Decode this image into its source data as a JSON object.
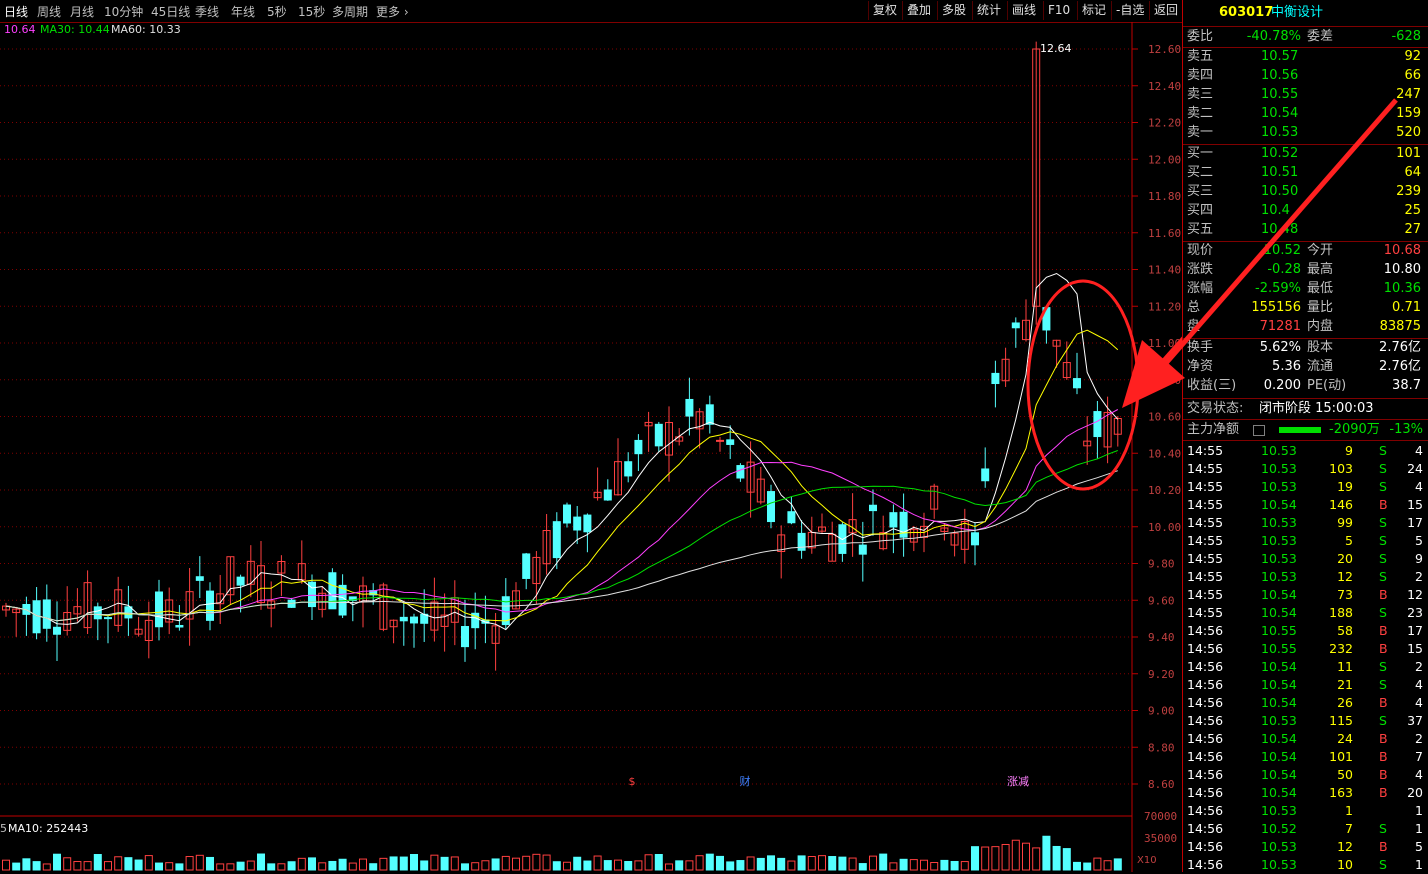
{
  "toolbar": {
    "periods": [
      "日线",
      "周线",
      "月线",
      "10分钟",
      "45日线",
      "季线",
      "年线",
      "5秒",
      "15秒",
      "多周期",
      "更多"
    ],
    "buttons": [
      "复权",
      "叠加",
      "多股",
      "统计",
      "画线",
      "F10",
      "标记",
      "-自选",
      "返回"
    ]
  },
  "ma_labels": {
    "current": "10.64",
    "ma30": "MA30: 10.44",
    "ma60": "MA60: 10.33"
  },
  "price_axis": [
    "12.60",
    "12.40",
    "12.20",
    "12.00",
    "11.80",
    "11.60",
    "11.40",
    "11.20",
    "11.00",
    "10.80",
    "10.60",
    "10.40",
    "10.20",
    "10.00",
    "9.80",
    "9.60",
    "9.40",
    "9.20",
    "9.00",
    "8.80",
    "8.60"
  ],
  "high_annotation": "12.64",
  "markers": {
    "m1": "$",
    "m2": "财",
    "m3": "涨减"
  },
  "volume": {
    "label_left": "5",
    "ma10": "MA10: 252443",
    "ticks": [
      "70000",
      "35000"
    ],
    "scale": "X10"
  },
  "stock": {
    "code": "603017",
    "name": "中衡设计"
  },
  "order_book": {
    "weibi_label": "委比",
    "weibi": "-40.78%",
    "weicha_label": "委差",
    "weicha": "-628",
    "sells": [
      {
        "label": "卖五",
        "price": "10.57",
        "vol": "92"
      },
      {
        "label": "卖四",
        "price": "10.56",
        "vol": "66"
      },
      {
        "label": "卖三",
        "price": "10.55",
        "vol": "247"
      },
      {
        "label": "卖二",
        "price": "10.54",
        "vol": "159"
      },
      {
        "label": "卖一",
        "price": "10.53",
        "vol": "520"
      }
    ],
    "buys": [
      {
        "label": "买一",
        "price": "10.52",
        "vol": "101"
      },
      {
        "label": "买二",
        "price": "10.51",
        "vol": "64"
      },
      {
        "label": "买三",
        "price": "10.50",
        "vol": "239"
      },
      {
        "label": "买四",
        "price": "10.4",
        "vol": "25"
      },
      {
        "label": "买五",
        "price": "10.48",
        "vol": "27"
      }
    ]
  },
  "quote": [
    {
      "l1": "现价",
      "v1": "10.52",
      "c1": "dn",
      "l2": "今开",
      "v2": "10.68",
      "c2": "up"
    },
    {
      "l1": "涨跌",
      "v1": "-0.28",
      "c1": "dn",
      "l2": "最高",
      "v2": "10.80",
      "c2": "wht"
    },
    {
      "l1": "涨幅",
      "v1": "-2.59%",
      "c1": "dn",
      "l2": "最低",
      "v2": "10.36",
      "c2": "dn"
    },
    {
      "l1": "总",
      "v1": "155156",
      "c1": "yel",
      "l2": "量比",
      "v2": "0.71",
      "c2": "yel"
    },
    {
      "l1": "盘",
      "v1": "71281",
      "c1": "up",
      "l2": "内盘",
      "v2": "83875",
      "c2": "yel"
    }
  ],
  "stats": [
    {
      "l1": "换手",
      "v1": "5.62%",
      "l2": "股本",
      "v2": "2.76亿"
    },
    {
      "l1": "净资",
      "v1": "5.36",
      "l2": "流通",
      "v2": "2.76亿"
    },
    {
      "l1": "收益(三)",
      "v1": "0.200",
      "l2": "PE(动)",
      "v2": "38.7"
    }
  ],
  "status": {
    "label": "交易状态:",
    "value": "闭市阶段 15:00:03"
  },
  "main_force": {
    "label": "主力净额",
    "value": "-2090万",
    "pct": "-13%"
  },
  "ticks": [
    {
      "t": "14:55",
      "p": "10.53",
      "v": "9",
      "d": "S",
      "n": "4"
    },
    {
      "t": "14:55",
      "p": "10.53",
      "v": "103",
      "d": "S",
      "n": "24"
    },
    {
      "t": "14:55",
      "p": "10.53",
      "v": "19",
      "d": "S",
      "n": "4"
    },
    {
      "t": "14:55",
      "p": "10.54",
      "v": "146",
      "d": "B",
      "n": "15"
    },
    {
      "t": "14:55",
      "p": "10.53",
      "v": "99",
      "d": "S",
      "n": "17"
    },
    {
      "t": "14:55",
      "p": "10.53",
      "v": "5",
      "d": "S",
      "n": "5"
    },
    {
      "t": "14:55",
      "p": "10.53",
      "v": "20",
      "d": "S",
      "n": "9"
    },
    {
      "t": "14:55",
      "p": "10.53",
      "v": "12",
      "d": "S",
      "n": "2"
    },
    {
      "t": "14:55",
      "p": "10.54",
      "v": "73",
      "d": "B",
      "n": "12"
    },
    {
      "t": "14:55",
      "p": "10.54",
      "v": "188",
      "d": "S",
      "n": "23"
    },
    {
      "t": "14:56",
      "p": "10.55",
      "v": "58",
      "d": "B",
      "n": "17"
    },
    {
      "t": "14:56",
      "p": "10.55",
      "v": "232",
      "d": "B",
      "n": "15"
    },
    {
      "t": "14:56",
      "p": "10.54",
      "v": "11",
      "d": "S",
      "n": "2"
    },
    {
      "t": "14:56",
      "p": "10.54",
      "v": "21",
      "d": "S",
      "n": "4"
    },
    {
      "t": "14:56",
      "p": "10.54",
      "v": "26",
      "d": "B",
      "n": "4"
    },
    {
      "t": "14:56",
      "p": "10.53",
      "v": "115",
      "d": "S",
      "n": "37"
    },
    {
      "t": "14:56",
      "p": "10.54",
      "v": "24",
      "d": "B",
      "n": "2"
    },
    {
      "t": "14:56",
      "p": "10.54",
      "v": "101",
      "d": "B",
      "n": "7"
    },
    {
      "t": "14:56",
      "p": "10.54",
      "v": "50",
      "d": "B",
      "n": "4"
    },
    {
      "t": "14:56",
      "p": "10.54",
      "v": "163",
      "d": "B",
      "n": "20"
    },
    {
      "t": "14:56",
      "p": "10.53",
      "v": "1",
      "d": "",
      "n": "1"
    },
    {
      "t": "14:56",
      "p": "10.52",
      "v": "7",
      "d": "S",
      "n": "1"
    },
    {
      "t": "14:56",
      "p": "10.53",
      "v": "12",
      "d": "B",
      "n": "5"
    },
    {
      "t": "14:56",
      "p": "10.53",
      "v": "10",
      "d": "S",
      "n": "1"
    }
  ],
  "colors": {
    "up": "#ff4040",
    "down": "#00e000",
    "candle_down": "#54ffff",
    "grid": "#800000",
    "highlight": "#ff2020"
  }
}
